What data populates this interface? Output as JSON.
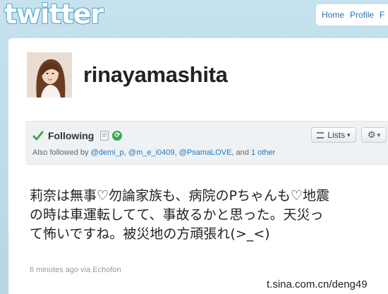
{
  "header": {
    "logo_text": "twitter",
    "nav": [
      "Home",
      "Profile",
      "F"
    ]
  },
  "profile": {
    "username": "rinayamashita"
  },
  "follow": {
    "status": "Following",
    "lists_label": "Lists",
    "gear_caret": "▾",
    "also_prefix": "Also followed by ",
    "followers": [
      "@demi_p",
      "@m_e_i0409",
      "@PsamaLOVE"
    ],
    "sep1": ", ",
    "sep2": ", ",
    "sep3": ", and ",
    "other": "1 other"
  },
  "tweet": {
    "text": "莉奈は無事♡勿論家族も、病院のPちゃんも♡地震の時は車運転してて、事故るかと思った。天災って怖いですね。被災地の方頑張れ(>_<)",
    "timestamp": "6 minutes ago",
    "via_prefix": " via ",
    "source": "Echofon"
  },
  "watermark": "t.sina.com.cn/deng49",
  "colors": {
    "link": "#2276bb",
    "check": "#3aa84a",
    "background": "#c6e2ee"
  }
}
